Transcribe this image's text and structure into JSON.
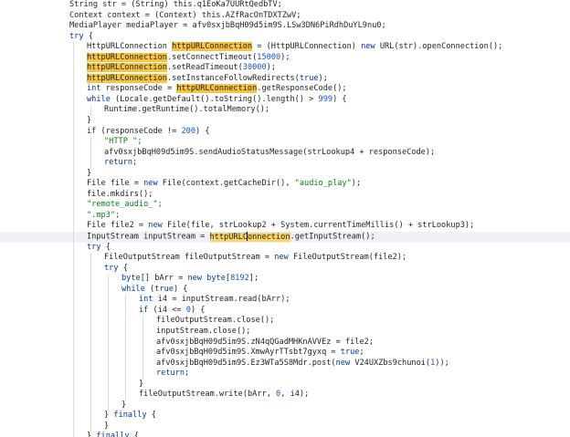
{
  "editor": {
    "lines": [
      {
        "indent": 2,
        "tokens": [
          [
            "String str = (String) this.",
            "plain"
          ],
          [
            "q1EoKa7UURtQedbTV",
            "plain"
          ],
          [
            ";",
            "plain"
          ]
        ]
      },
      {
        "indent": 2,
        "tokens": [
          [
            "Context context = (Context) this.AZfRacOnTDXTZwV;",
            "plain"
          ]
        ]
      },
      {
        "indent": 2,
        "tokens": [
          [
            "MediaPlayer mediaPlayer = afv0sxjbBqH09d5im9S.LSw3DN6PiRdhDuYL9nu0;",
            "plain"
          ]
        ]
      },
      {
        "indent": 2,
        "tokens": [
          [
            "try",
            "kw"
          ],
          [
            " {",
            "plain"
          ]
        ]
      },
      {
        "indent": 3,
        "tokens": [
          [
            "HttpURLConnection ",
            "plain"
          ],
          [
            "httpURLConnection",
            "hl"
          ],
          [
            " = (HttpURLConnection) ",
            "plain"
          ],
          [
            "new",
            "kw"
          ],
          [
            " URL(str).openConnection();",
            "plain"
          ]
        ]
      },
      {
        "indent": 3,
        "tokens": [
          [
            "httpURLConnection",
            "hl"
          ],
          [
            ".setConnectTimeout(",
            "plain"
          ],
          [
            "15000",
            "num"
          ],
          [
            ");",
            "plain"
          ]
        ]
      },
      {
        "indent": 3,
        "tokens": [
          [
            "httpURLConnection",
            "hl"
          ],
          [
            ".setReadTimeout(",
            "plain"
          ],
          [
            "30000",
            "num"
          ],
          [
            ");",
            "plain"
          ]
        ]
      },
      {
        "indent": 3,
        "tokens": [
          [
            "httpURLConnection",
            "hl"
          ],
          [
            ".setInstanceFollowRedirects(",
            "plain"
          ],
          [
            "true",
            "kw"
          ],
          [
            ");",
            "plain"
          ]
        ]
      },
      {
        "indent": 3,
        "tokens": [
          [
            "int",
            "kw"
          ],
          [
            " responseCode = ",
            "plain"
          ],
          [
            "httpURLConnection",
            "hl"
          ],
          [
            ".getResponseCode();",
            "plain"
          ]
        ]
      },
      {
        "indent": 3,
        "tokens": [
          [
            "while",
            "kw"
          ],
          [
            " (Locale.getDefault().toString().length() > ",
            "plain"
          ],
          [
            "999",
            "num"
          ],
          [
            ") {",
            "plain"
          ]
        ]
      },
      {
        "indent": 4,
        "tokens": [
          [
            "Runtime.getRuntime().totalMemory();",
            "plain"
          ]
        ]
      },
      {
        "indent": 3,
        "tokens": [
          [
            "}",
            "plain"
          ]
        ]
      },
      {
        "indent": 3,
        "tokens": [
          [
            "if",
            "kw"
          ],
          [
            " (responseCode != ",
            "plain"
          ],
          [
            "200",
            "num"
          ],
          [
            ") {",
            "plain"
          ]
        ]
      },
      {
        "indent": 4,
        "tokens": [
          [
            "\"HTTP \";",
            "str"
          ]
        ]
      },
      {
        "indent": 4,
        "tokens": [
          [
            "afv0sxjbBqH09d5im9S.sendAudioStatusMessage(strLookup4 + responseCode);",
            "plain"
          ]
        ]
      },
      {
        "indent": 4,
        "tokens": [
          [
            "return",
            "kw"
          ],
          [
            ";",
            "plain"
          ]
        ]
      },
      {
        "indent": 3,
        "tokens": [
          [
            "}",
            "plain"
          ]
        ]
      },
      {
        "indent": 3,
        "tokens": [
          [
            "File file = ",
            "plain"
          ],
          [
            "new",
            "kw"
          ],
          [
            " File(context.getCacheDir(), ",
            "plain"
          ],
          [
            "\"audio_play\"",
            "str"
          ],
          [
            ");",
            "plain"
          ]
        ]
      },
      {
        "indent": 3,
        "tokens": [
          [
            "file.mkdirs();",
            "plain"
          ]
        ]
      },
      {
        "indent": 3,
        "tokens": [
          [
            "\"remote_audio_\";",
            "str"
          ]
        ]
      },
      {
        "indent": 3,
        "tokens": [
          [
            "\".mp3\";",
            "str"
          ]
        ]
      },
      {
        "indent": 3,
        "tokens": [
          [
            "File file2 = ",
            "plain"
          ],
          [
            "new",
            "kw"
          ],
          [
            " File(file, strLookup2 + System.currentTimeMillis() + strLookup3);",
            "plain"
          ]
        ]
      },
      {
        "indent": 3,
        "row_highlight": true,
        "tokens": [
          [
            "InputStream inputStream = ",
            "plain"
          ],
          [
            "httpURLC",
            "hl2"
          ],
          [
            "|",
            "caret"
          ],
          [
            "onnection",
            "hl2"
          ],
          [
            ".getInputStream();",
            "plain"
          ]
        ]
      },
      {
        "indent": 3,
        "tokens": [
          [
            "try",
            "kw"
          ],
          [
            " {",
            "plain"
          ]
        ]
      },
      {
        "indent": 4,
        "tokens": [
          [
            "FileOutputStream fileOutputStream = ",
            "plain"
          ],
          [
            "new",
            "kw"
          ],
          [
            " FileOutputStream(file2);",
            "plain"
          ]
        ]
      },
      {
        "indent": 4,
        "tokens": [
          [
            "try",
            "kw"
          ],
          [
            " {",
            "plain"
          ]
        ]
      },
      {
        "indent": 5,
        "tokens": [
          [
            "byte",
            "kw"
          ],
          [
            "[] bArr = ",
            "plain"
          ],
          [
            "new",
            "kw"
          ],
          [
            " ",
            "plain"
          ],
          [
            "byte",
            "kw"
          ],
          [
            "[",
            "plain"
          ],
          [
            "8192",
            "num"
          ],
          [
            "];",
            "plain"
          ]
        ]
      },
      {
        "indent": 5,
        "tokens": [
          [
            "while",
            "kw"
          ],
          [
            " (",
            "plain"
          ],
          [
            "true",
            "kw"
          ],
          [
            ") {",
            "plain"
          ]
        ]
      },
      {
        "indent": 6,
        "tokens": [
          [
            "int",
            "kw"
          ],
          [
            " i4 = inputStream.read(bArr);",
            "plain"
          ]
        ]
      },
      {
        "indent": 6,
        "tokens": [
          [
            "if",
            "kw"
          ],
          [
            " (i4 <= ",
            "plain"
          ],
          [
            "0",
            "num"
          ],
          [
            ") {",
            "plain"
          ]
        ]
      },
      {
        "indent": 7,
        "tokens": [
          [
            "fileOutputStream.close();",
            "plain"
          ]
        ]
      },
      {
        "indent": 7,
        "tokens": [
          [
            "inputStream.close();",
            "plain"
          ]
        ]
      },
      {
        "indent": 7,
        "tokens": [
          [
            "afv0sxjbBqH09d5im9S.zN4qQGadMHKnAVVEz = file2;",
            "plain"
          ]
        ]
      },
      {
        "indent": 7,
        "tokens": [
          [
            "afv0sxjbBqH09d5im9S.XmwAyrTTsbt7gyxq = ",
            "plain"
          ],
          [
            "true",
            "kw"
          ],
          [
            ";",
            "plain"
          ]
        ]
      },
      {
        "indent": 7,
        "tokens": [
          [
            "afv0sxjbBqH09d5im9S.Ez3WTa5S8Mdr.post(",
            "plain"
          ],
          [
            "new",
            "kw"
          ],
          [
            " V24UXZbs9chunoi(",
            "plain"
          ],
          [
            "1",
            "num"
          ],
          [
            "));",
            "plain"
          ]
        ]
      },
      {
        "indent": 7,
        "tokens": [
          [
            "return",
            "kw"
          ],
          [
            ";",
            "plain"
          ]
        ]
      },
      {
        "indent": 6,
        "tokens": [
          [
            "}",
            "plain"
          ]
        ]
      },
      {
        "indent": 6,
        "tokens": [
          [
            "fileOutputStream.write(bArr, ",
            "plain"
          ],
          [
            "0",
            "num"
          ],
          [
            ", i4);",
            "plain"
          ]
        ]
      },
      {
        "indent": 5,
        "tokens": [
          [
            "}",
            "plain"
          ]
        ]
      },
      {
        "indent": 4,
        "tokens": [
          [
            "} ",
            "plain"
          ],
          [
            "finally",
            "kw"
          ],
          [
            " {",
            "plain"
          ]
        ]
      },
      {
        "indent": 4,
        "tokens": [
          [
            "}",
            "plain"
          ]
        ]
      },
      {
        "indent": 3,
        "tokens": [
          [
            "} ",
            "plain"
          ],
          [
            "finally",
            "kw"
          ],
          [
            " {",
            "plain"
          ]
        ]
      }
    ]
  },
  "colors": {
    "background": "#ffffff",
    "keyword": "#0033b3",
    "string": "#067d17",
    "number": "#1750eb",
    "highlight": "#f5c542",
    "current_line": "#eef1f6"
  }
}
